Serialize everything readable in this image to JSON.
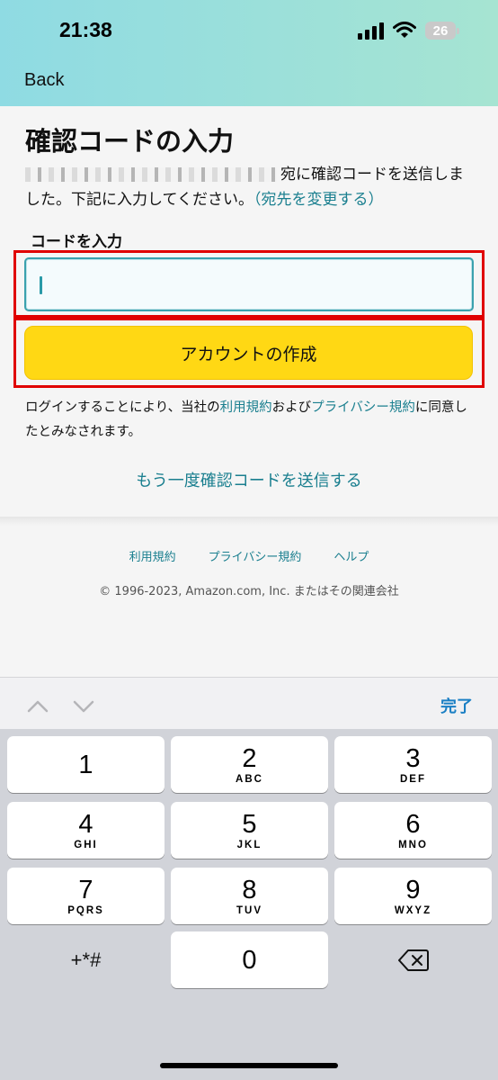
{
  "status_bar": {
    "time": "21:38",
    "battery": "26",
    "icons": [
      "signal-icon",
      "wifi-icon",
      "battery-icon"
    ]
  },
  "nav": {
    "back_label": "Back"
  },
  "main": {
    "title": "確認コードの入力",
    "instructions_suffix": "宛に確認コードを送信しました。下記に入力してください。",
    "change_recipient_link": "（宛先を変更する）",
    "code_label": "コードを入力",
    "code_value": "",
    "create_button_label": "アカウントの作成",
    "legal_prefix": "ログインすることにより、当社の",
    "terms_link": "利用規約",
    "legal_and": "および",
    "privacy_link": "プライバシー規約",
    "legal_suffix": "に同意したとみなされます。",
    "resend_link": "もう一度確認コードを送信する"
  },
  "footer": {
    "links": [
      "利用規約",
      "プライバシー規約",
      "ヘルプ"
    ],
    "copyright": "© 1996-2023, Amazon.com, Inc. またはその関連会社"
  },
  "keyboard_toolbar": {
    "done_label": "完了",
    "icons": [
      "chevron-up-icon",
      "chevron-down-icon"
    ]
  },
  "keypad": {
    "keys": [
      {
        "num": "1",
        "letters": ""
      },
      {
        "num": "2",
        "letters": "ABC"
      },
      {
        "num": "3",
        "letters": "DEF"
      },
      {
        "num": "4",
        "letters": "GHI"
      },
      {
        "num": "5",
        "letters": "JKL"
      },
      {
        "num": "6",
        "letters": "MNO"
      },
      {
        "num": "7",
        "letters": "PQRS"
      },
      {
        "num": "8",
        "letters": "TUV"
      },
      {
        "num": "9",
        "letters": "WXYZ"
      },
      {
        "num": "0",
        "letters": ""
      }
    ],
    "symbols_label": "+*#"
  },
  "colors": {
    "accent_teal": "#1a7f8f",
    "button_yellow": "#ffd814",
    "highlight_red": "#e00000"
  }
}
